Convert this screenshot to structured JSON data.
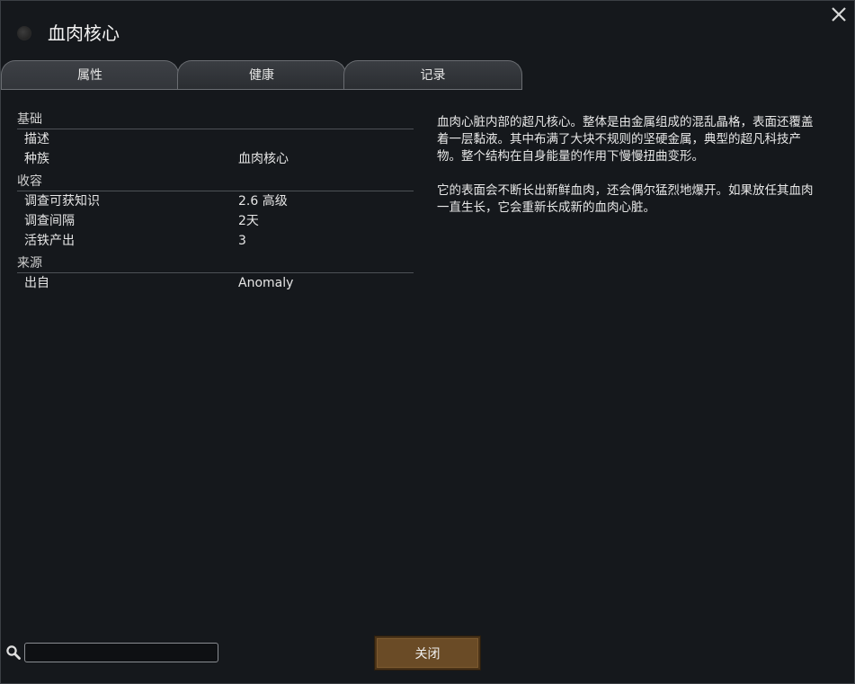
{
  "window": {
    "title": "血肉核心"
  },
  "tabs": [
    {
      "label": "属性"
    },
    {
      "label": "健康"
    },
    {
      "label": "记录"
    }
  ],
  "stats": {
    "sections": [
      {
        "header": "基础",
        "rows": [
          {
            "label": "描述",
            "value": ""
          },
          {
            "label": "种族",
            "value": "血肉核心"
          }
        ]
      },
      {
        "header": "收容",
        "rows": [
          {
            "label": "调查可获知识",
            "value": "2.6 高级"
          },
          {
            "label": "调查间隔",
            "value": "2天"
          },
          {
            "label": "活铁产出",
            "value": "3"
          }
        ]
      },
      {
        "header": "来源",
        "rows": [
          {
            "label": "出自",
            "value": "Anomaly"
          }
        ]
      }
    ]
  },
  "description": {
    "paragraphs": [
      "血肉心脏内部的超凡核心。整体是由金属组成的混乱晶格，表面还覆盖着一层黏液。其中布满了大块不规则的坚硬金属，典型的超凡科技产物。整个结构在自身能量的作用下慢慢扭曲变形。",
      "它的表面会不断长出新鲜血肉，还会偶尔猛烈地爆开。如果放任其血肉一直生长，它会重新长成新的血肉心脏。"
    ]
  },
  "search": {
    "value": "",
    "icon": "search-icon"
  },
  "footer": {
    "close_label": "关闭"
  },
  "colors": {
    "background": "#15181c",
    "button": "#6a4b26"
  }
}
